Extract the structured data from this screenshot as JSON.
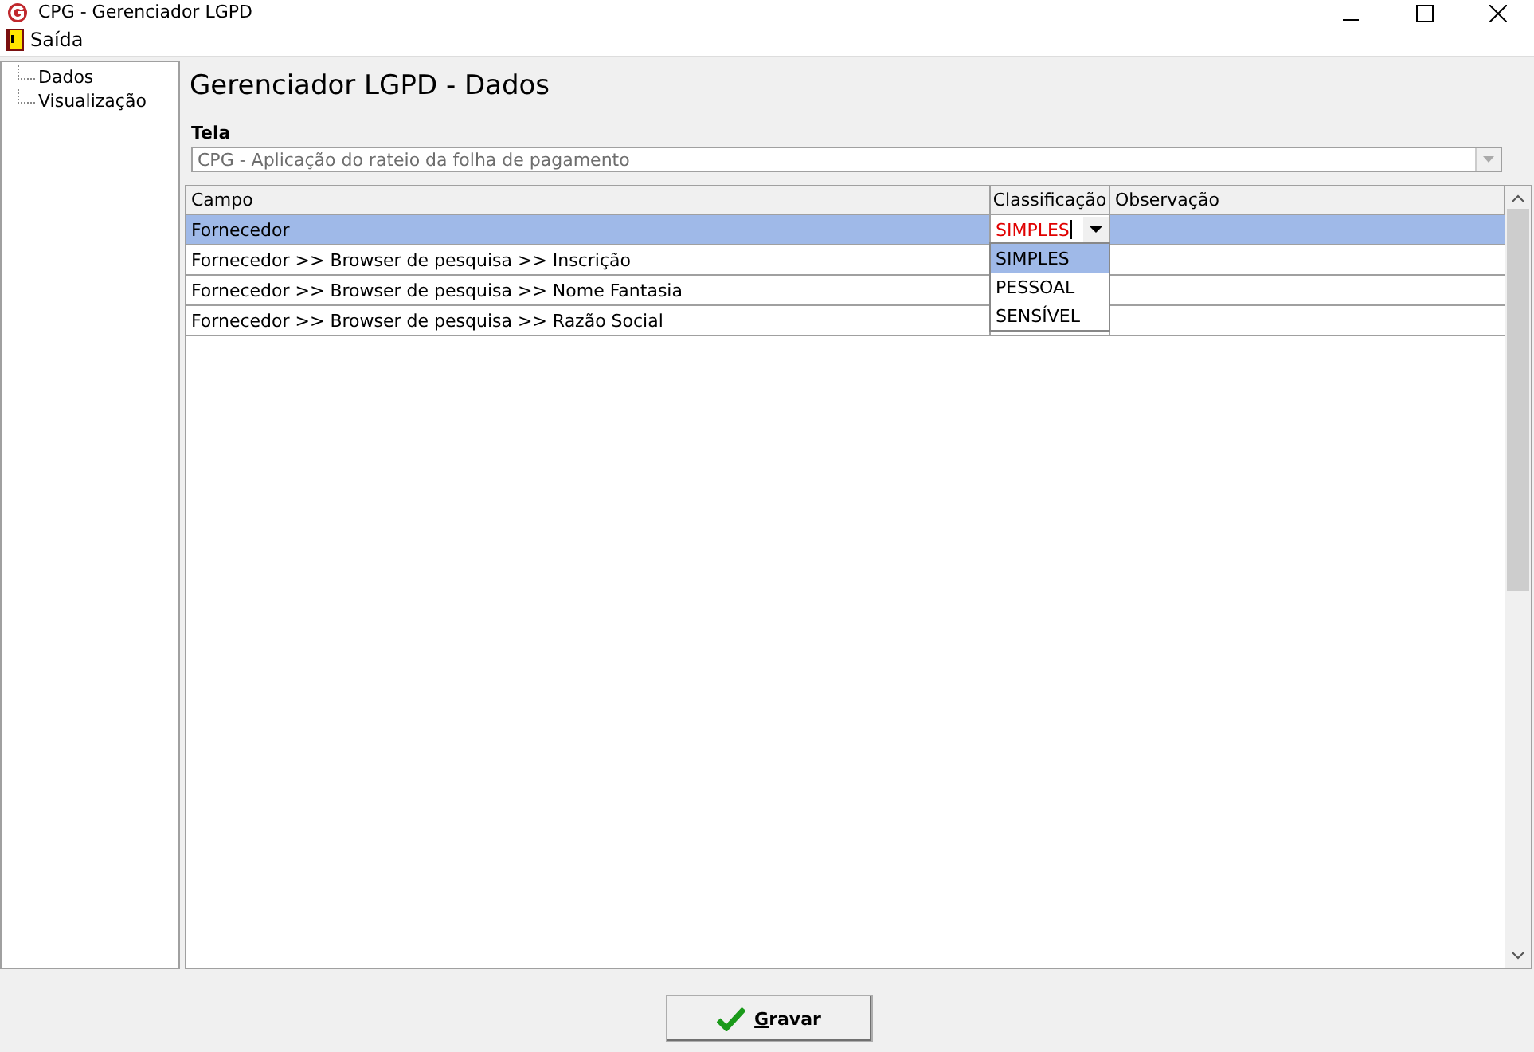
{
  "window": {
    "title": "CPG - Gerenciador LGPD"
  },
  "menu": [
    {
      "label": "Saída"
    }
  ],
  "tree": [
    {
      "label": "Dados",
      "selected": false
    },
    {
      "label": "Visualização",
      "selected": false
    }
  ],
  "heading": "Gerenciador LGPD - Dados",
  "tela": {
    "label": "Tela",
    "value": "CPG - Aplicação do rateio da folha de pagamento"
  },
  "table": {
    "columns": [
      "Campo",
      "Classificação",
      "Observação"
    ],
    "rows": [
      {
        "campo": "Fornecedor",
        "classificacao": "SIMPLES",
        "selected": true
      },
      {
        "campo": "Fornecedor >> Browser de pesquisa >> Inscrição",
        "selected": false
      },
      {
        "campo": "Fornecedor >> Browser de pesquisa >> Nome Fantasia",
        "selected": false
      },
      {
        "campo": "Fornecedor >> Browser de pesquisa >> Razão Social",
        "selected": false
      }
    ],
    "dropdown": [
      {
        "label": "SIMPLES",
        "selected": true
      },
      {
        "label": "PESSOAL",
        "selected": false
      },
      {
        "label": "SENSÍVEL",
        "selected": false
      }
    ]
  },
  "save_button": {
    "label": "Gravar"
  }
}
